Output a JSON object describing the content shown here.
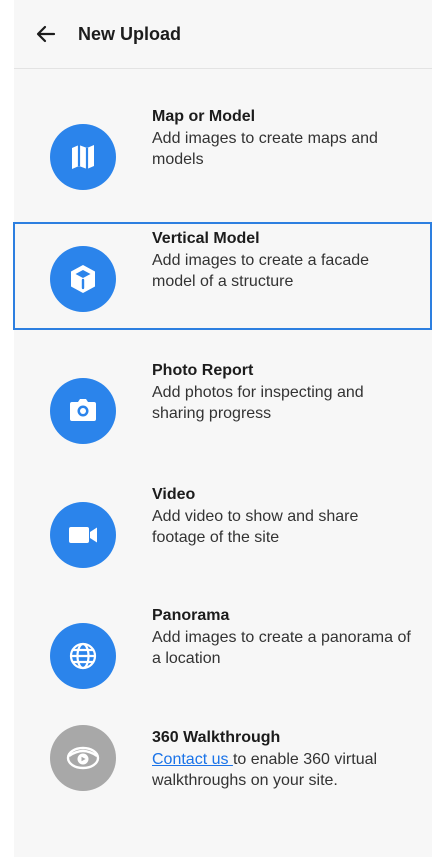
{
  "header": {
    "title": "New Upload",
    "back_icon": "arrow-left-icon"
  },
  "accent_color": "#2b84eb",
  "selected_border_color": "#2d7fe0",
  "disabled_color": "#a8a8a8",
  "options": [
    {
      "title": "Map or Model",
      "description": "Add images to create maps and models",
      "icon": "map-icon"
    },
    {
      "title": "Vertical Model",
      "description": "Add images to create a facade model of a structure",
      "icon": "cube-icon",
      "selected": true
    },
    {
      "title": "Photo Report",
      "description": "Add photos for inspecting and sharing progress",
      "icon": "camera-icon"
    },
    {
      "title": "Video",
      "description": "Add video to show and share footage of the site",
      "icon": "video-camera-icon"
    },
    {
      "title": "Panorama",
      "description": "Add images to create a panorama of a location",
      "icon": "globe-icon"
    },
    {
      "title": "360 Walkthrough",
      "link_text": "Contact us ",
      "description_after_link": "to enable 360 virtual walkthroughs on your site.",
      "icon": "360-view-icon",
      "disabled": true
    }
  ]
}
